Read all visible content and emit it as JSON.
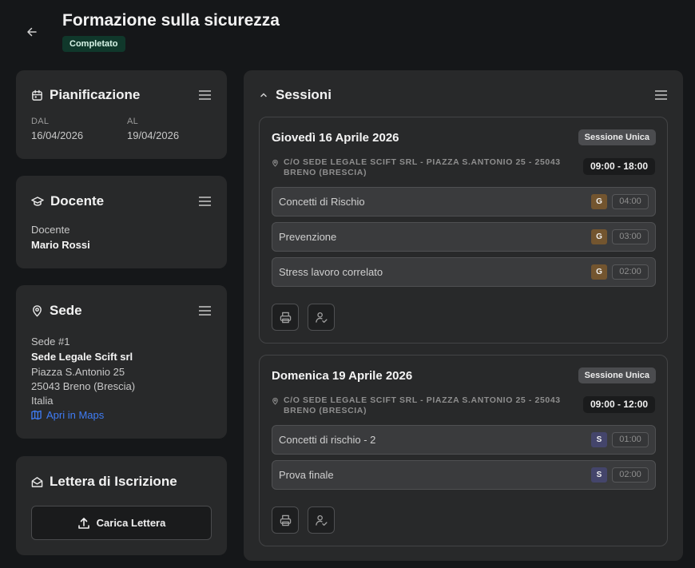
{
  "header": {
    "title": "Formazione sulla sicurezza",
    "status": "Completato"
  },
  "planning": {
    "title": "Pianificazione",
    "from_label": "DAL",
    "from_value": "16/04/2026",
    "to_label": "AL",
    "to_value": "19/04/2026"
  },
  "teacher": {
    "title": "Docente",
    "label": "Docente",
    "name": "Mario Rossi"
  },
  "venue": {
    "title": "Sede",
    "number": "Sede #1",
    "name": "Sede Legale Scift srl",
    "street": "Piazza S.Antonio 25",
    "city": "25043 Breno (Brescia)",
    "country": "Italia",
    "maps_link": "Apri in Maps"
  },
  "letter": {
    "title": "Lettera di Iscrizione",
    "upload_label": "Carica Lettera"
  },
  "sessions": {
    "title": "Sessioni",
    "items": [
      {
        "date": "Giovedì 16 Aprile 2026",
        "badge": "Sessione Unica",
        "location": "C/O SEDE LEGALE SCIFT SRL - PIAZZA S.ANTONIO 25 - 25043 BRENO (BRESCIA)",
        "time": "09:00 - 18:00",
        "modules": [
          {
            "name": "Concetti di Rischio",
            "type": "G",
            "duration": "04:00"
          },
          {
            "name": "Prevenzione",
            "type": "G",
            "duration": "03:00"
          },
          {
            "name": "Stress lavoro correlato",
            "type": "G",
            "duration": "02:00"
          }
        ]
      },
      {
        "date": "Domenica 19 Aprile 2026",
        "badge": "Sessione Unica",
        "location": "C/O SEDE LEGALE SCIFT SRL - PIAZZA S.ANTONIO 25 - 25043 BRENO (BRESCIA)",
        "time": "09:00 - 12:00",
        "modules": [
          {
            "name": "Concetti di rischio - 2",
            "type": "S",
            "duration": "01:00"
          },
          {
            "name": "Prova finale",
            "type": "S",
            "duration": "02:00"
          }
        ]
      }
    ]
  },
  "colors": {
    "background": "#151719",
    "card": "#28292a",
    "status_badge": "#10382b",
    "link": "#3f7cf5",
    "type_g": "#73552f",
    "type_s": "#44456b"
  }
}
